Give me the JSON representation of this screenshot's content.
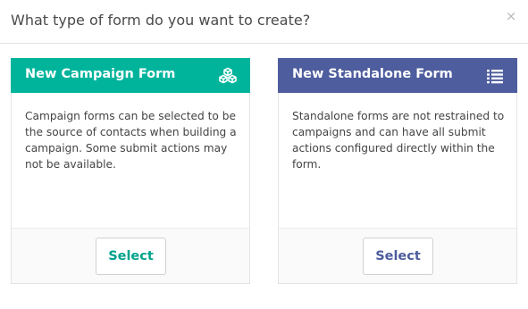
{
  "dialog": {
    "title": "What type of form do you want to create?",
    "close_glyph": "×",
    "close_icon": "close-icon"
  },
  "cards": [
    {
      "title": "New Campaign Form",
      "icon": "cubes-icon",
      "accent_color": "#00b49c",
      "description": "Campaign forms can be selected to be the source of contacts when building a campaign. Some submit actions may not be available.",
      "button_label": "Select"
    },
    {
      "title": "New Standalone Form",
      "icon": "list-icon",
      "accent_color": "#4e5d9d",
      "description": "Standalone forms are not restrained to campaigns and can have all submit actions configured directly within the form.",
      "button_label": "Select"
    }
  ]
}
